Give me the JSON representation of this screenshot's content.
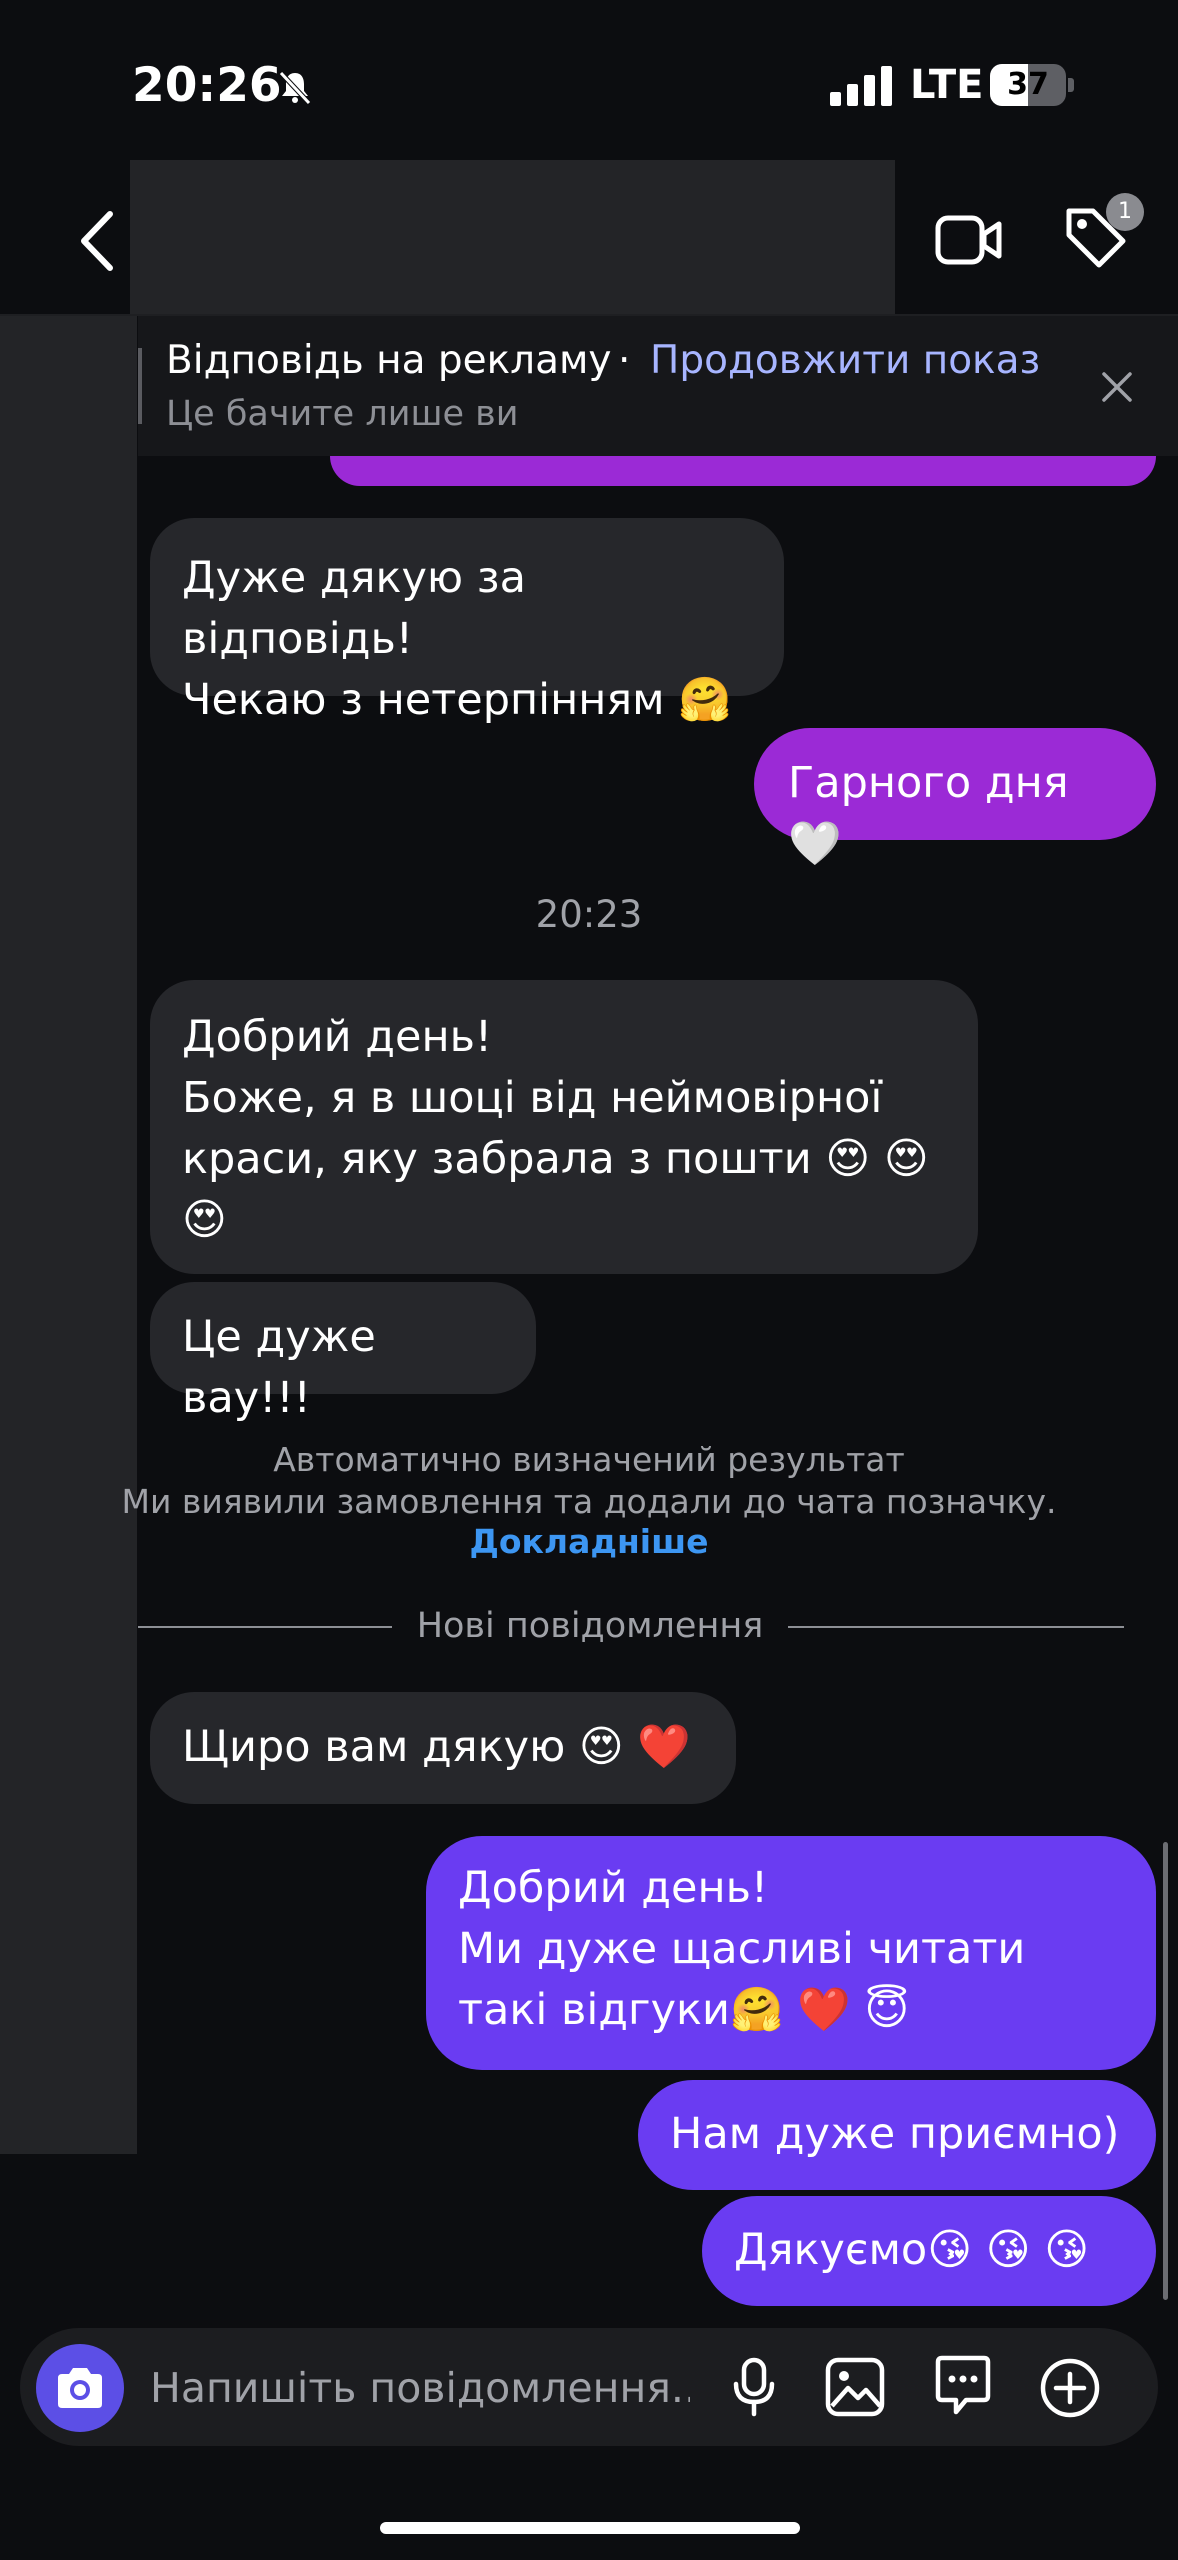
{
  "status_bar": {
    "time": "20:26",
    "network": "LTE",
    "battery": "37"
  },
  "header": {
    "notification_count": "1"
  },
  "ad_banner": {
    "title": "Відповідь на рекламу",
    "separator": "·",
    "link": "Продовжити показ",
    "subtitle": "Це бачите лише ви"
  },
  "messages": [
    {
      "direction": "incoming",
      "text": "Дуже дякую за відповідь!\nЧекаю з нетерпінням 🤗"
    },
    {
      "direction": "outgoing",
      "text": "Гарного дня🤍"
    },
    {
      "direction": "incoming",
      "text": "Добрий день!\nБоже, я в шоці від неймовірної краси, яку забрала з пошти 😍 😍\n😍"
    },
    {
      "direction": "incoming",
      "text": "Це дуже вау!!!"
    },
    {
      "direction": "incoming",
      "text": "Щиро вам дякую 😍 ❤️"
    },
    {
      "direction": "outgoing",
      "text": "Добрий день!\nМи дуже щасливі читати такі відгуки🤗 ❤️ 😇"
    },
    {
      "direction": "outgoing",
      "text": "Нам дуже приємно)"
    },
    {
      "direction": "outgoing",
      "text": "Дякуємо😘 😘 😘"
    }
  ],
  "timestamp": "20:23",
  "auto_notice": {
    "line1": "Автоматично визначений результат",
    "line2": "Ми виявили замовлення та додали до чата позначку.",
    "link": "Докладніше"
  },
  "new_messages_label": "Нові повідомлення",
  "composer": {
    "placeholder": "Напишіть повідомлення..."
  },
  "icons": {
    "back": "chevron-left-icon",
    "video": "video-camera-icon",
    "tag": "tag-icon",
    "close": "close-icon",
    "camera": "camera-icon",
    "mic": "microphone-icon",
    "gallery": "image-icon",
    "sticker": "sticker-icon",
    "plus": "plus-circle-icon"
  },
  "colors": {
    "background": "#0c0d10",
    "incoming_bubble": "#26272b",
    "outgoing_purple": "#9b2ad6",
    "outgoing_violet": "#6a3cf2",
    "link_blue": "#3d96f2",
    "ad_link": "#a7b5ff"
  }
}
